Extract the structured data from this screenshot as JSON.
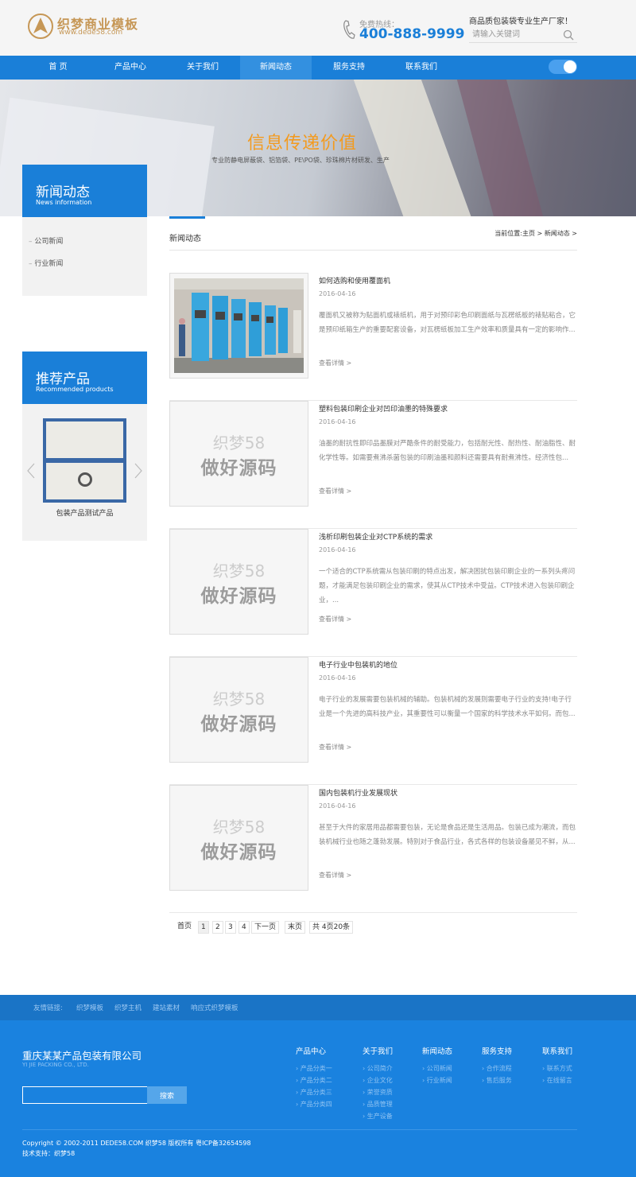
{
  "header": {
    "logo_title": "织梦商业模板",
    "logo_url": "www.dede58.com",
    "hotline_label": "免费热线：",
    "hotline_number": "400-888-9999",
    "slogan": "商品质包装袋专业生产厂家！",
    "search_placeholder": "请输入关键词"
  },
  "nav": {
    "items": [
      "首 页",
      "产品中心",
      "关于我们",
      "新闻动态",
      "服务支持",
      "联系我们"
    ],
    "active_index": 3
  },
  "banner": {
    "title": "信息传递价值",
    "subtitle": "专业防静电屏蔽袋、铝箔袋、PE\\PO袋、珍珠棉片材研发、生产"
  },
  "sidebar": {
    "news_box": {
      "title": "新闻动态",
      "subtitle": "News information",
      "links": [
        "公司新闻",
        "行业新闻"
      ]
    },
    "products_box": {
      "title": "推荐产品",
      "subtitle": "Recommended products",
      "caption": "包装产品测试产品"
    }
  },
  "main": {
    "title": "新闻动态",
    "breadcrumb": "当前位置:主页 > 新闻动态 >",
    "placeholder_line1": "织梦58",
    "placeholder_line2": "做好源码",
    "read_more": "查看详情 >",
    "news": [
      {
        "title": "如何选购和使用覆面机",
        "date": "2016-04-16",
        "summary": "覆面机又被称为贴面机或裱纸机，用于对预印彩色印刷面纸与瓦楞纸板的裱贴粘合，它是预印纸箱生产的重要配套设备，对瓦楞纸板加工生产效率和质量具有一定的影响作..."
      },
      {
        "title": "塑料包装印刷企业对凹印油墨的特殊要求",
        "date": "2016-04-16",
        "summary": "油墨的耐抗性即印品墨膜对严酷条件的耐受能力，包括耐光性、耐热性、耐油脂性、耐化学性等。如需要煮沸杀菌包装的印刷油墨和颜料还需要具有耐煮沸性。经济性包..."
      },
      {
        "title": "浅析印刷包装企业对CTP系统的需求",
        "date": "2016-04-16",
        "summary": "一个适合的CTP系统需从包装印刷的特点出发，解决困扰包装印刷企业的一系列头疼问题，才能满足包装印刷企业的需求，使其从CTP技术中受益。CTP技术进入包装印刷企业，..."
      },
      {
        "title": "电子行业中包装机的地位",
        "date": "2016-04-16",
        "summary": "电子行业的发展需要包装机械的辅助。包装机械的发展则需要电子行业的支持!电子行业是一个先进的高科技产业，其重要性可以衡量一个国家的科学技术水平如何。而包..."
      },
      {
        "title": "国内包装机行业发展现状",
        "date": "2016-04-16",
        "summary": "甚至于大件的家居用品都需要包装，无论是食品还是生活用品。包装已成为潮流，而包装机械行业也随之蓬勃发展。特别对于食品行业，各式各样的包装设备屡见不鲜，从..."
      }
    ]
  },
  "pagination": {
    "first": "首页",
    "pages": [
      "1",
      "2",
      "3",
      "4"
    ],
    "current": "1",
    "next": "下一页",
    "last": "末页",
    "summary": "共 4页20条"
  },
  "friend_links": {
    "label": "友情链接:",
    "items": [
      "织梦模板",
      "织梦主机",
      "建站素材",
      "响应式织梦模板"
    ]
  },
  "footer": {
    "company": "重庆某某产品包装有限公司",
    "company_en": "YI JIE PACKING CO., LTD.",
    "search_button": "搜索",
    "columns": [
      {
        "title": "产品中心",
        "links": [
          "产品分类一",
          "产品分类二",
          "产品分类三",
          "产品分类四"
        ]
      },
      {
        "title": "关于我们",
        "links": [
          "公司简介",
          "企业文化",
          "荣誉资质",
          "品质管理",
          "生产设备"
        ]
      },
      {
        "title": "新闻动态",
        "links": [
          "公司新闻",
          "行业新闻"
        ]
      },
      {
        "title": "服务支持",
        "links": [
          "合作流程",
          "售后服务"
        ]
      },
      {
        "title": "联系我们",
        "links": [
          "联系方式",
          "在线留言"
        ]
      }
    ],
    "copyright": "Copyright © 2002-2011 DEDE58.COM 织梦58 版权所有 粤ICP备32654598",
    "support": "技术支持：织梦58"
  },
  "colors": {
    "brand_blue": "#1a7fd8",
    "accent_orange": "#f39a1e",
    "logo_gold": "#c69756"
  }
}
